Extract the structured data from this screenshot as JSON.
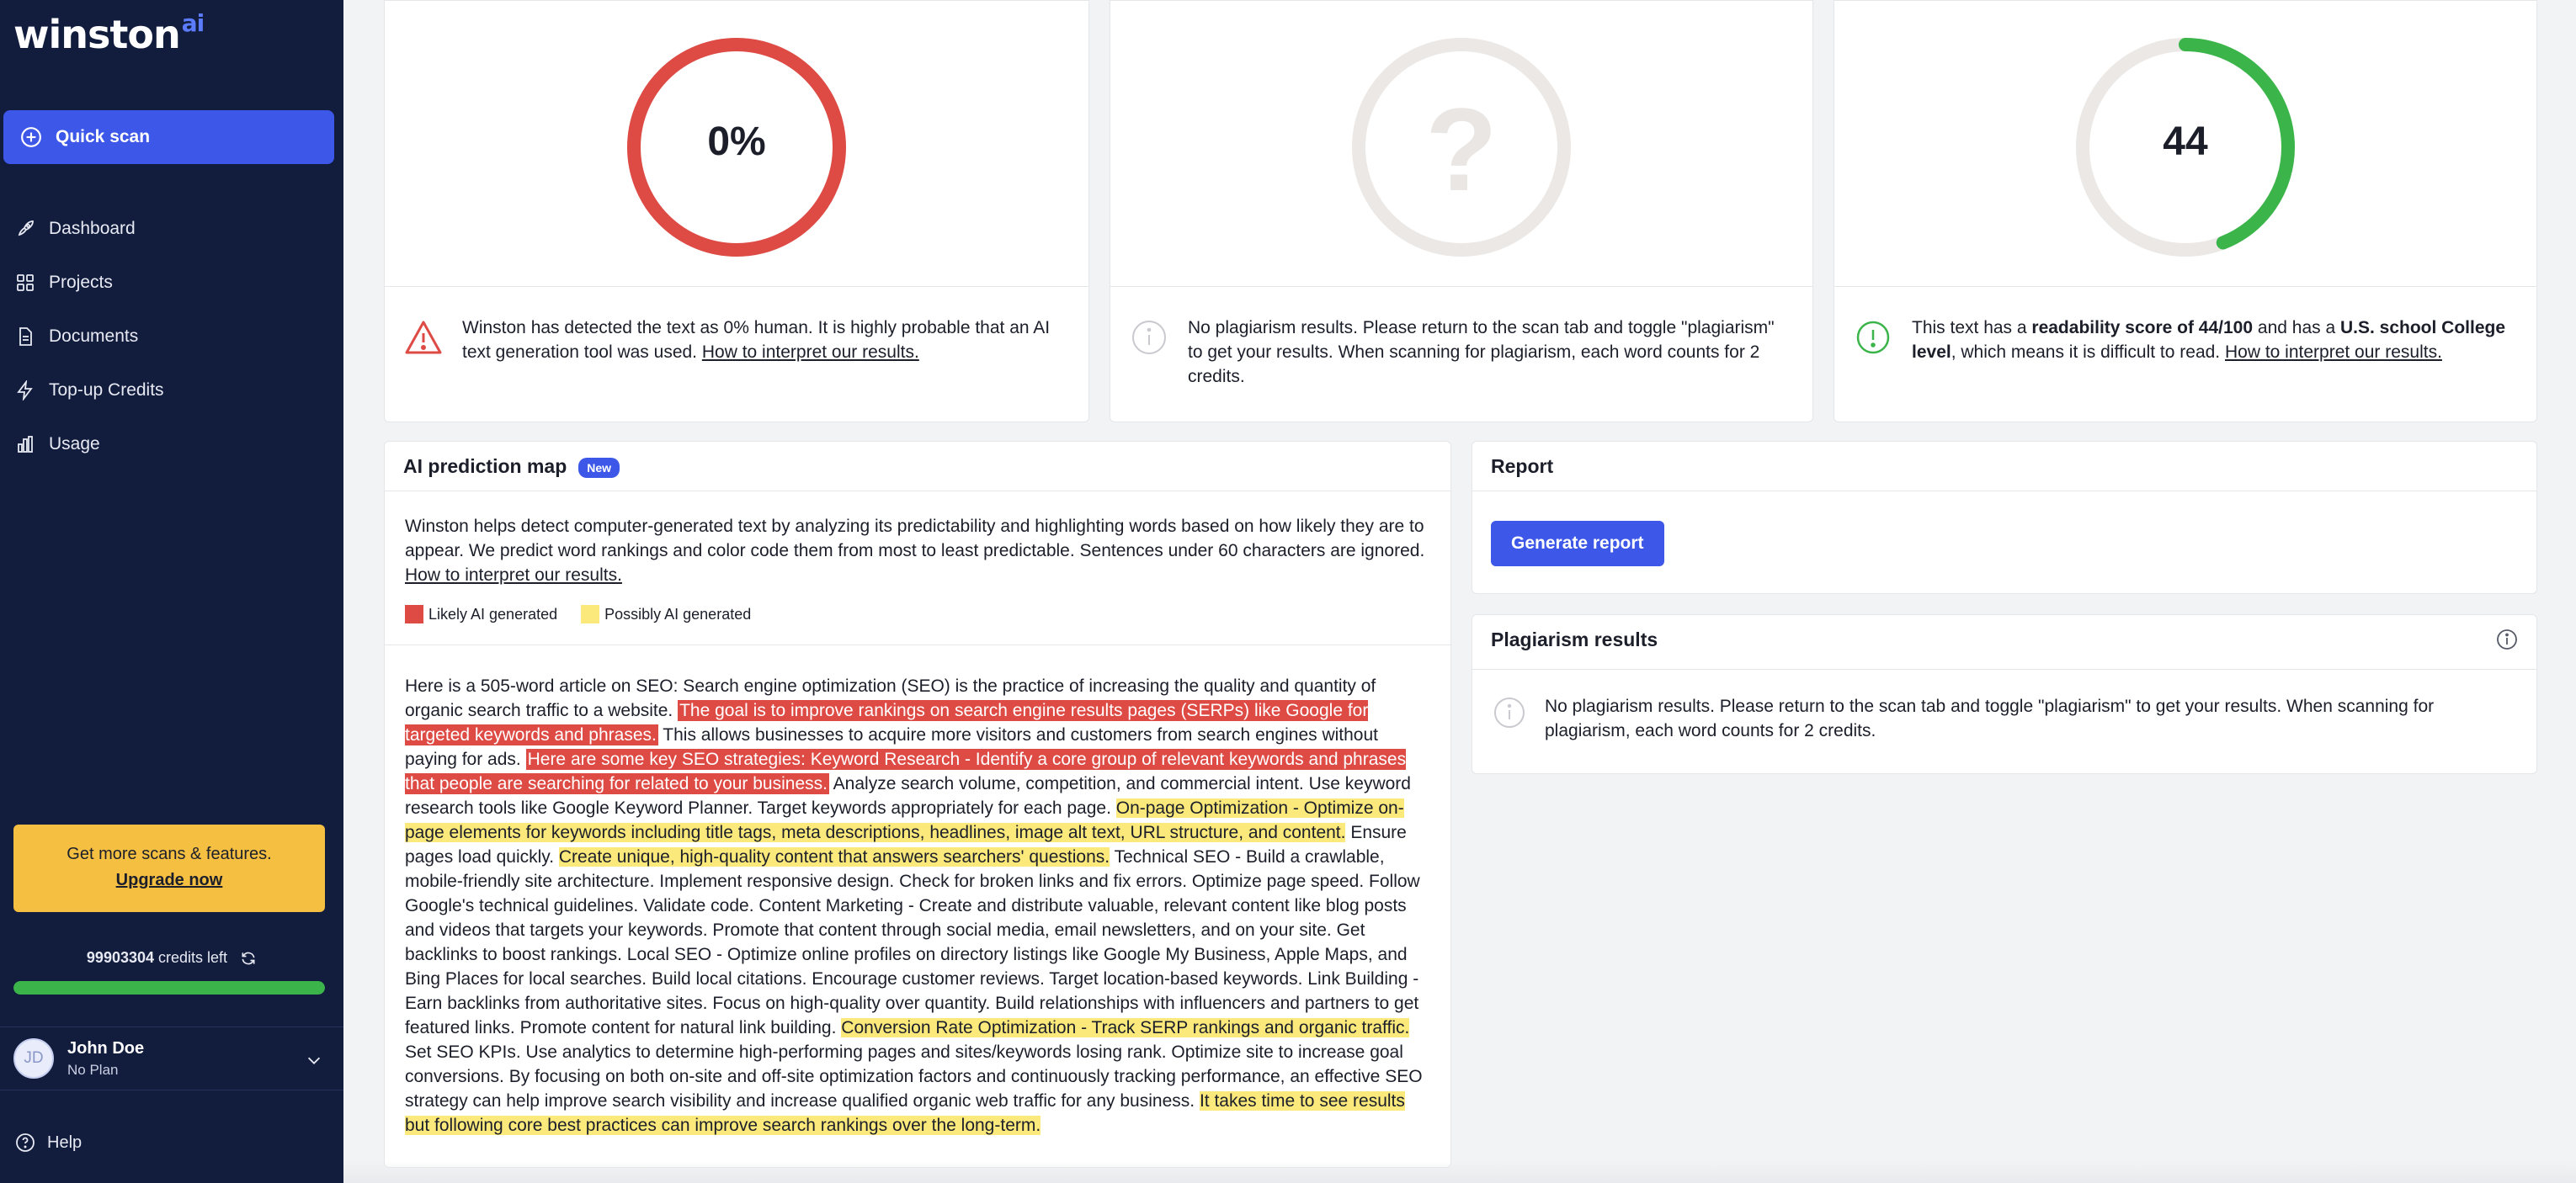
{
  "sidebar": {
    "logo": "winston",
    "logo_suffix": "ai",
    "quick_scan": "Quick scan",
    "nav": [
      {
        "label": "Dashboard",
        "icon": "rocket-icon"
      },
      {
        "label": "Projects",
        "icon": "grid-icon"
      },
      {
        "label": "Documents",
        "icon": "document-icon"
      },
      {
        "label": "Top-up Credits",
        "icon": "lightning-icon"
      },
      {
        "label": "Usage",
        "icon": "bar-chart-icon"
      }
    ],
    "upgrade_text": "Get more scans & features.",
    "upgrade_link": "Upgrade now",
    "credits_count": "99903304",
    "credits_suffix": "credits left",
    "credits_fraction": 0.999,
    "user_initials": "JD",
    "user_name": "John Doe",
    "user_plan": "No Plan",
    "help": "Help"
  },
  "scores": {
    "human": {
      "value": "0%",
      "fraction": 1.0,
      "color": "#de4a44",
      "msg": "Winston has detected the text as 0% human. It is highly probable that an AI text generation tool was used.",
      "link": "How to interpret our results."
    },
    "plagiarism": {
      "value": "?",
      "msg": "No plagiarism results. Please return to the scan tab and toggle \"plagiarism\" to get your results. When scanning for plagiarism, each word counts for 2 credits."
    },
    "readability": {
      "value": "44",
      "fraction": 0.44,
      "color": "#3bb54a",
      "msg_pre": "This text has a",
      "msg_b1": "readability score of 44/100",
      "msg_mid": "and has a",
      "msg_b2": "U.S. school College level",
      "msg_post": ", which means it is difficult to read.",
      "link": "How to interpret our results."
    }
  },
  "prediction": {
    "title": "AI prediction map",
    "badge": "New",
    "intro": "Winston helps detect computer-generated text by analyzing its predictability and highlighting words based on how likely they are to appear. We predict word rankings and color code them from most to least predictable. Sentences under 60 characters are ignored.",
    "intro_link": "How to interpret our results.",
    "legend_red": "Likely AI generated",
    "legend_yellow": "Possibly AI generated",
    "article": [
      {
        "t": "Here is a 505-word article on SEO: Search engine optimization (SEO) is the practice of increasing the quality and quantity of organic search traffic to a website. ",
        "c": ""
      },
      {
        "t": "The goal is to improve rankings on search engine results pages (SERPs) like Google for targeted keywords and phrases.",
        "c": "red"
      },
      {
        "t": " This allows businesses to acquire more visitors and customers from search engines without paying for ads. ",
        "c": ""
      },
      {
        "t": "Here are some key SEO strategies: Keyword Research - Identify a core group of relevant keywords and phrases that people are searching for related to your business.",
        "c": "red"
      },
      {
        "t": " Analyze search volume, competition, and commercial intent. Use keyword research tools like Google Keyword Planner. Target keywords appropriately for each page. ",
        "c": ""
      },
      {
        "t": "On-page Optimization - Optimize on-page elements for keywords including title tags, meta descriptions, headlines, image alt text, URL structure, and content.",
        "c": "yellow"
      },
      {
        "t": " Ensure pages load quickly. ",
        "c": ""
      },
      {
        "t": "Create unique, high-quality content that answers searchers' questions.",
        "c": "yellow"
      },
      {
        "t": " Technical SEO - Build a crawlable, mobile-friendly site architecture. Implement responsive design. Check for broken links and fix errors. Optimize page speed. Follow Google's technical guidelines. Validate code. Content Marketing - Create and distribute valuable, relevant content like blog posts and videos that targets your keywords. Promote that content through social media, email newsletters, and on your site. Get backlinks to boost rankings. Local SEO - Optimize online profiles on directory listings like Google My Business, Apple Maps, and Bing Places for local searches. Build local citations. Encourage customer reviews. Target location-based keywords. Link Building - Earn backlinks from authoritative sites. Focus on high-quality over quantity. Build relationships with influencers and partners to get featured links. Promote content for natural link building. ",
        "c": ""
      },
      {
        "t": "Conversion Rate Optimization - Track SERP rankings and organic traffic.",
        "c": "yellow"
      },
      {
        "t": " Set SEO KPIs. Use analytics to determine high-performing pages and sites/keywords losing rank. Optimize site to increase goal conversions. By focusing on both on-site and off-site optimization factors and continuously tracking performance, an effective SEO strategy can help improve search visibility and increase qualified organic web traffic for any business. ",
        "c": ""
      },
      {
        "t": "It takes time to see results but following core best practices can improve search rankings over the long-term.",
        "c": "yellow"
      }
    ]
  },
  "report": {
    "title": "Report",
    "button": "Generate report"
  },
  "plagiarism_results": {
    "title": "Plagiarism results",
    "msg": "No plagiarism results. Please return to the scan tab and toggle \"plagiarism\" to get your results. When scanning for plagiarism, each word counts for 2 credits."
  }
}
